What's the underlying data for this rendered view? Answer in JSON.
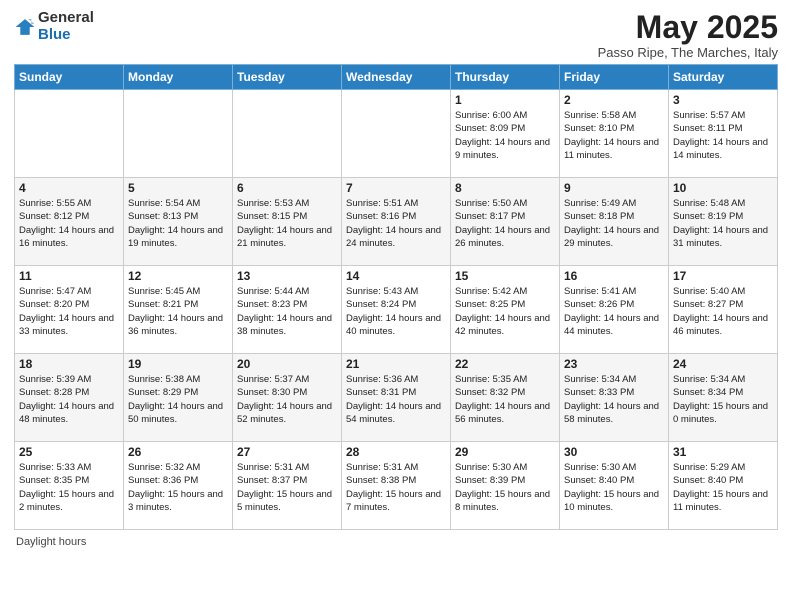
{
  "header": {
    "logo_general": "General",
    "logo_blue": "Blue",
    "month_title": "May 2025",
    "subtitle": "Passo Ripe, The Marches, Italy"
  },
  "days_of_week": [
    "Sunday",
    "Monday",
    "Tuesday",
    "Wednesday",
    "Thursday",
    "Friday",
    "Saturday"
  ],
  "weeks": [
    [
      {
        "day": "",
        "info": ""
      },
      {
        "day": "",
        "info": ""
      },
      {
        "day": "",
        "info": ""
      },
      {
        "day": "",
        "info": ""
      },
      {
        "day": "1",
        "info": "Sunrise: 6:00 AM\nSunset: 8:09 PM\nDaylight: 14 hours\nand 9 minutes."
      },
      {
        "day": "2",
        "info": "Sunrise: 5:58 AM\nSunset: 8:10 PM\nDaylight: 14 hours\nand 11 minutes."
      },
      {
        "day": "3",
        "info": "Sunrise: 5:57 AM\nSunset: 8:11 PM\nDaylight: 14 hours\nand 14 minutes."
      }
    ],
    [
      {
        "day": "4",
        "info": "Sunrise: 5:55 AM\nSunset: 8:12 PM\nDaylight: 14 hours\nand 16 minutes."
      },
      {
        "day": "5",
        "info": "Sunrise: 5:54 AM\nSunset: 8:13 PM\nDaylight: 14 hours\nand 19 minutes."
      },
      {
        "day": "6",
        "info": "Sunrise: 5:53 AM\nSunset: 8:15 PM\nDaylight: 14 hours\nand 21 minutes."
      },
      {
        "day": "7",
        "info": "Sunrise: 5:51 AM\nSunset: 8:16 PM\nDaylight: 14 hours\nand 24 minutes."
      },
      {
        "day": "8",
        "info": "Sunrise: 5:50 AM\nSunset: 8:17 PM\nDaylight: 14 hours\nand 26 minutes."
      },
      {
        "day": "9",
        "info": "Sunrise: 5:49 AM\nSunset: 8:18 PM\nDaylight: 14 hours\nand 29 minutes."
      },
      {
        "day": "10",
        "info": "Sunrise: 5:48 AM\nSunset: 8:19 PM\nDaylight: 14 hours\nand 31 minutes."
      }
    ],
    [
      {
        "day": "11",
        "info": "Sunrise: 5:47 AM\nSunset: 8:20 PM\nDaylight: 14 hours\nand 33 minutes."
      },
      {
        "day": "12",
        "info": "Sunrise: 5:45 AM\nSunset: 8:21 PM\nDaylight: 14 hours\nand 36 minutes."
      },
      {
        "day": "13",
        "info": "Sunrise: 5:44 AM\nSunset: 8:23 PM\nDaylight: 14 hours\nand 38 minutes."
      },
      {
        "day": "14",
        "info": "Sunrise: 5:43 AM\nSunset: 8:24 PM\nDaylight: 14 hours\nand 40 minutes."
      },
      {
        "day": "15",
        "info": "Sunrise: 5:42 AM\nSunset: 8:25 PM\nDaylight: 14 hours\nand 42 minutes."
      },
      {
        "day": "16",
        "info": "Sunrise: 5:41 AM\nSunset: 8:26 PM\nDaylight: 14 hours\nand 44 minutes."
      },
      {
        "day": "17",
        "info": "Sunrise: 5:40 AM\nSunset: 8:27 PM\nDaylight: 14 hours\nand 46 minutes."
      }
    ],
    [
      {
        "day": "18",
        "info": "Sunrise: 5:39 AM\nSunset: 8:28 PM\nDaylight: 14 hours\nand 48 minutes."
      },
      {
        "day": "19",
        "info": "Sunrise: 5:38 AM\nSunset: 8:29 PM\nDaylight: 14 hours\nand 50 minutes."
      },
      {
        "day": "20",
        "info": "Sunrise: 5:37 AM\nSunset: 8:30 PM\nDaylight: 14 hours\nand 52 minutes."
      },
      {
        "day": "21",
        "info": "Sunrise: 5:36 AM\nSunset: 8:31 PM\nDaylight: 14 hours\nand 54 minutes."
      },
      {
        "day": "22",
        "info": "Sunrise: 5:35 AM\nSunset: 8:32 PM\nDaylight: 14 hours\nand 56 minutes."
      },
      {
        "day": "23",
        "info": "Sunrise: 5:34 AM\nSunset: 8:33 PM\nDaylight: 14 hours\nand 58 minutes."
      },
      {
        "day": "24",
        "info": "Sunrise: 5:34 AM\nSunset: 8:34 PM\nDaylight: 15 hours\nand 0 minutes."
      }
    ],
    [
      {
        "day": "25",
        "info": "Sunrise: 5:33 AM\nSunset: 8:35 PM\nDaylight: 15 hours\nand 2 minutes."
      },
      {
        "day": "26",
        "info": "Sunrise: 5:32 AM\nSunset: 8:36 PM\nDaylight: 15 hours\nand 3 minutes."
      },
      {
        "day": "27",
        "info": "Sunrise: 5:31 AM\nSunset: 8:37 PM\nDaylight: 15 hours\nand 5 minutes."
      },
      {
        "day": "28",
        "info": "Sunrise: 5:31 AM\nSunset: 8:38 PM\nDaylight: 15 hours\nand 7 minutes."
      },
      {
        "day": "29",
        "info": "Sunrise: 5:30 AM\nSunset: 8:39 PM\nDaylight: 15 hours\nand 8 minutes."
      },
      {
        "day": "30",
        "info": "Sunrise: 5:30 AM\nSunset: 8:40 PM\nDaylight: 15 hours\nand 10 minutes."
      },
      {
        "day": "31",
        "info": "Sunrise: 5:29 AM\nSunset: 8:40 PM\nDaylight: 15 hours\nand 11 minutes."
      }
    ]
  ],
  "footer": {
    "daylight_label": "Daylight hours"
  }
}
